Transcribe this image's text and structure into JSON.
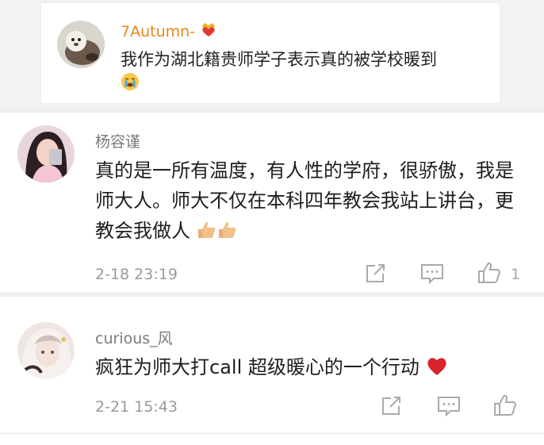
{
  "reply_quote": {
    "username": "7Autumn-",
    "content": "我作为湖北籍贵师学子表示真的被学校暖到",
    "badge_icon": "crown-heart-icon",
    "trailing_emoji": "crying-face-icon"
  },
  "comments": [
    {
      "username": "杨容谨",
      "content": "真的是一所有温度，有人性的学府，很骄傲，我是师大人。师大不仅在本科四年教会我站上讲台，更教会我做人",
      "trailing_emoji": "thumbs-up-icon",
      "time": "2-18 23:19",
      "like_count": "1"
    },
    {
      "username": "curious_风",
      "content": "疯狂为师大打call 超级暖心的一个行动",
      "trailing_emoji": "red-heart-icon",
      "time": "2-21 15:43",
      "like_count": ""
    }
  ],
  "colors": {
    "accent_username": "#e8861a",
    "username_gray": "#7a7a7a",
    "meta_gray": "#9a9a9a",
    "heart_red": "#d7232b"
  }
}
